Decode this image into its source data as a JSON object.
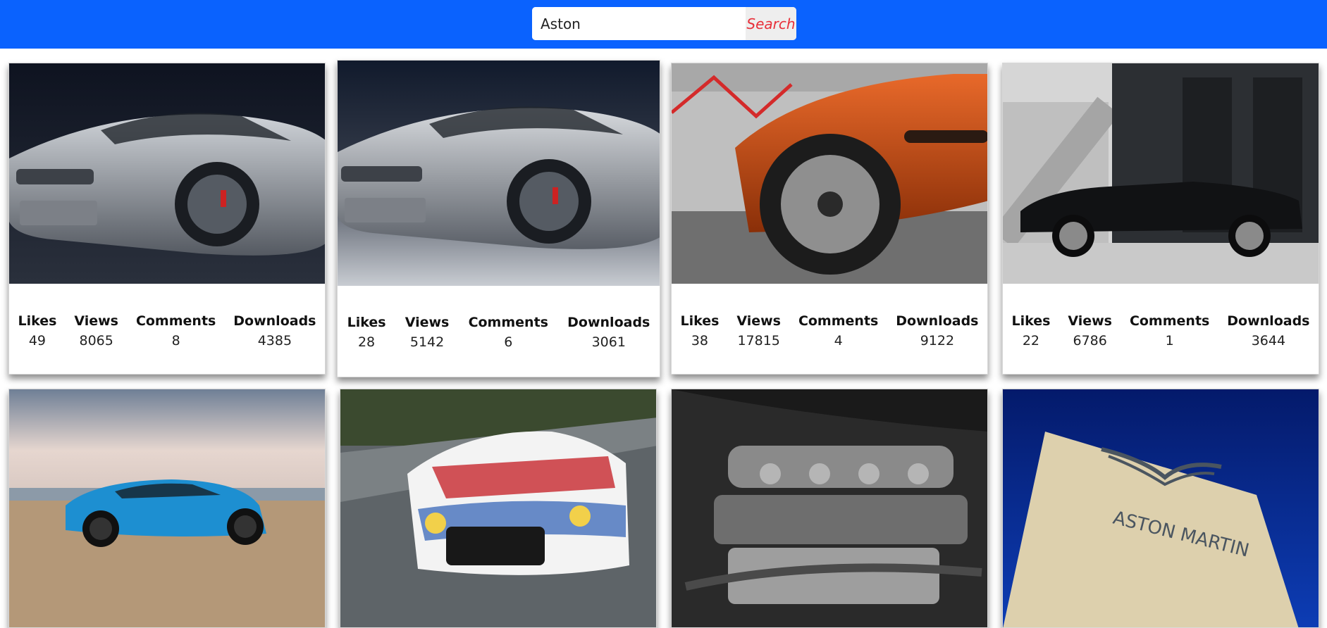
{
  "search": {
    "value": "Aston",
    "button_label": "Search"
  },
  "stat_labels": [
    "Likes",
    "Views",
    "Comments",
    "Downloads"
  ],
  "cards": [
    {
      "image": "silver-concept-car-dark",
      "stats": [
        "49",
        "8065",
        "8",
        "4385"
      ]
    },
    {
      "image": "silver-concept-car-light",
      "stats": [
        "28",
        "5142",
        "6",
        "3061"
      ]
    },
    {
      "image": "orange-car-wheel",
      "stats": [
        "38",
        "17815",
        "4",
        "9122"
      ]
    },
    {
      "image": "black-convertible",
      "stats": [
        "22",
        "6786",
        "1",
        "3644"
      ]
    },
    {
      "image": "blue-coupe-beach"
    },
    {
      "image": "race-car-total"
    },
    {
      "image": "engine-bay-mono"
    },
    {
      "image": "aston-martin-sign",
      "sign_text": "ASTON MARTIN"
    }
  ],
  "colors": {
    "header": "#0a62fe",
    "search_button_text": "#e8303a"
  }
}
